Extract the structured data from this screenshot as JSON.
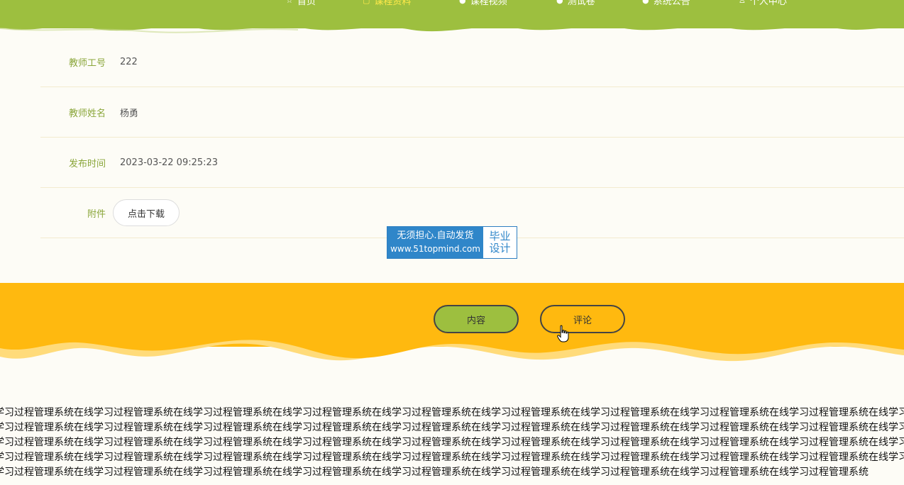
{
  "nav": {
    "items": [
      {
        "label": "首页",
        "icon": "star-icon"
      },
      {
        "label": "课程资料",
        "icon": "document-icon",
        "active": true
      },
      {
        "label": "课程视频",
        "icon": "circle-icon"
      },
      {
        "label": "测试卷",
        "icon": "circle-icon"
      },
      {
        "label": "系统公告",
        "icon": "circle-icon"
      },
      {
        "label": "个人中心",
        "icon": "user-icon"
      }
    ]
  },
  "detail": {
    "rows": [
      {
        "label": "教师工号",
        "value": "222"
      },
      {
        "label": "教师姓名",
        "value": "杨勇"
      },
      {
        "label": "发布时间",
        "value": "2023-03-22 09:25:23"
      }
    ],
    "attachment_label": "附件",
    "download_button": "点击下载"
  },
  "watermark": {
    "line1": "无须担心.自动发货",
    "line2": "www.51topmind.com",
    "side1": "毕业",
    "side2": "设计"
  },
  "tabs": {
    "content_label": "内容",
    "comment_label": "评论"
  },
  "colors": {
    "nav_green": "#9dbf3f",
    "accent_orange": "#ffb90f",
    "label_green": "#8aa63a",
    "active_yellow": "#ffe94a"
  },
  "footer": {
    "lines": [
      "学习过程管理系统在线学习过程管理系统在线学习过程管理系统在线学习过程管理系统在线学习过程管理系统在线学习过程管理系统在线学习过程管理系统在线学习过程管理系统在线学习过程管理系统在线学习过程管理系统在线学习过程管理系统在线学习过程管理系统在线学习过程管理系统在线学",
      "学习过程管理系统在线学习过程管理系统在线学习过程管理系统在线学习过程管理系统在线学习过程管理系统在线学习过程管理系统在线学习过程管理系统在线学习过程管理系统在线学习过程管理系统在线学习过程管理系统在线学习过程管理系统在线学习过程管理系统在线学习过程管理系统在线学",
      "学习过程管理系统在线学习过程管理系统在线学习过程管理系统在线学习过程管理系统在线学习过程管理系统在线学习过程管理系统在线学习过程管理系统在线学习过程管理系统在线学习过程管理系统在线学习过程管理系统在线学习过程管理系统在线学习过程管理系统在线学习过程管理系统在线学",
      "学习过程管理系统在线学习过程管理系统在线学习过程管理系统在线学习过程管理系统在线学习过程管理系统在线学习过程管理系统在线学习过程管理系统在线学习过程管理系统在线学习过程管理系统在线学习过程管理系统在线学习过程管理系统在线学习过程管理系统在线学习过程管理系统在线学",
      "学习过程管理系统在线学习过程管理系统在线学习过程管理系统在线学习过程管理系统在线学习过程管理系统在线学习过程管理系统在线学习过程管理系统在线学习过程管理系统在线学习过程管理系统"
    ]
  }
}
